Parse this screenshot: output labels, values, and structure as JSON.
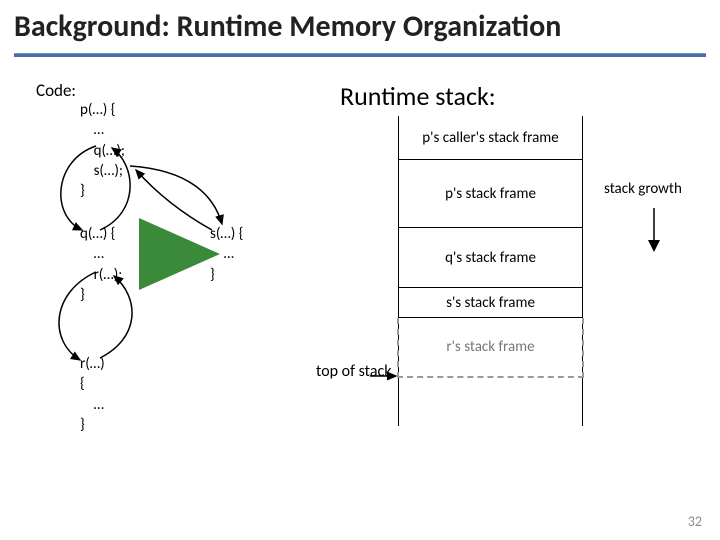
{
  "title": "Background: Runtime Memory Organization",
  "labels": {
    "code": "Code:",
    "runtime_stack": "Runtime stack:",
    "top_of_stack": "top of\nstack",
    "stack_growth": "stack growth"
  },
  "code": {
    "p": "p(…) {\n    …\n    q(…);\n    s(…);\n}",
    "q": "q(…) {\n    …\n    r(…);\n}",
    "s": "s(…) {\n    …\n}",
    "r": "r(…)\n{\n    …\n}"
  },
  "frames": {
    "f1": "p's caller's stack frame",
    "f2": "p's stack frame",
    "f3": "q's stack frame",
    "f4": "s's stack frame",
    "f5": "r's stack frame"
  },
  "page_number": "32"
}
